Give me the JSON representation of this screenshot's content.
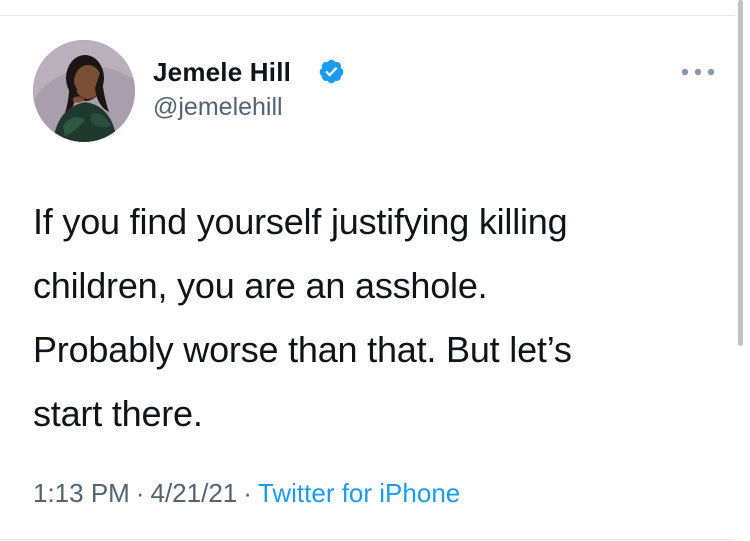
{
  "author": {
    "display_name": "Jemele Hill",
    "handle": "@jemelehill",
    "verified": true,
    "avatar_icon": "profile-photo"
  },
  "menu_icon": "more-horizontal-icon",
  "tweet": {
    "lines": [
      "If you find yourself justifying killing",
      "children, you are an asshole.",
      "Probably worse than that. But let’s",
      "start there."
    ]
  },
  "meta": {
    "time": "1:13 PM",
    "separator": "·",
    "date": "4/21/21",
    "source": "Twitter for iPhone"
  },
  "colors": {
    "text": "#0f1419",
    "secondary": "#536471",
    "link": "#1d9bf0",
    "verified": "#1d9bf0",
    "divider": "#e1e8ed"
  }
}
